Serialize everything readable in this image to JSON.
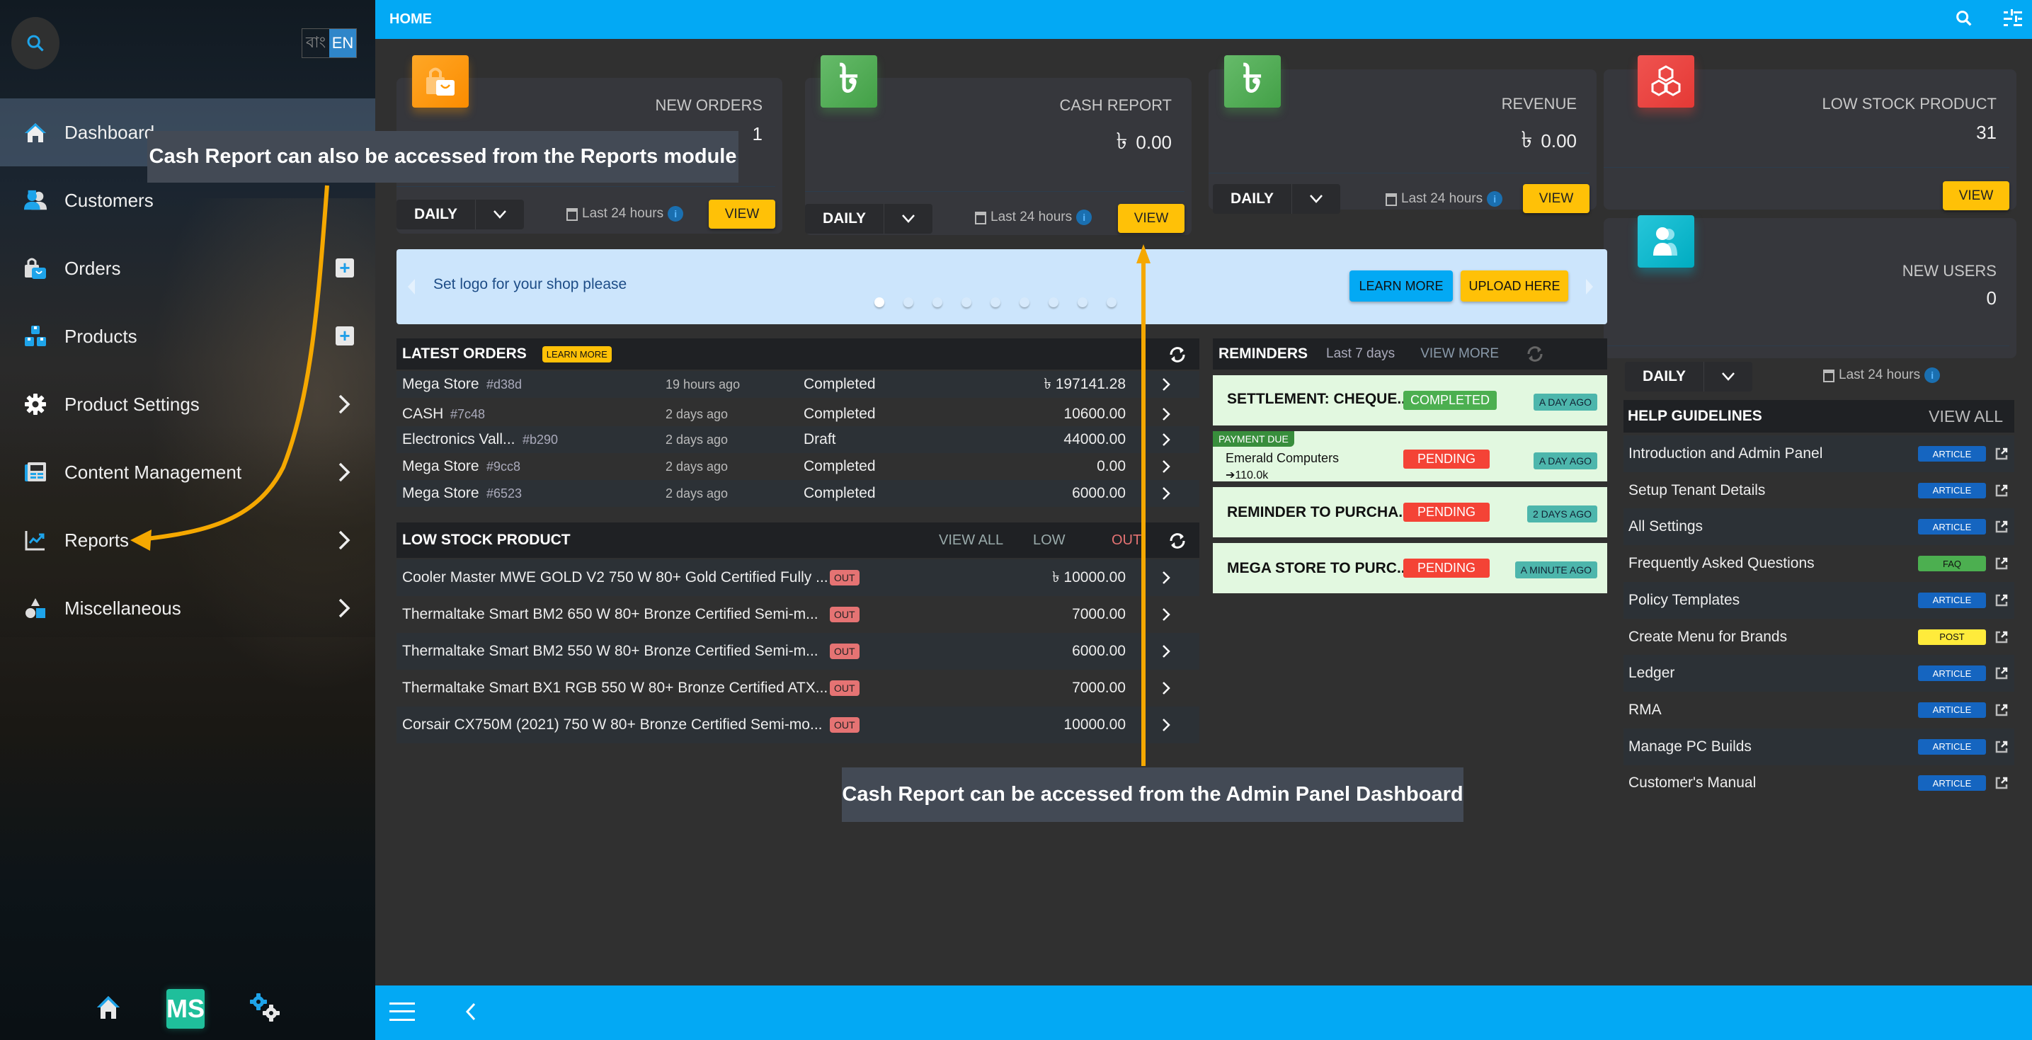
{
  "sidebar": {
    "search_icon": "search-icon",
    "lang": {
      "bn": "বাং",
      "en": "EN",
      "active": "EN"
    },
    "items": [
      {
        "label": "Dashboard",
        "icon": "home-icon",
        "active": true
      },
      {
        "label": "Customers",
        "icon": "customers-icon"
      },
      {
        "label": "Orders",
        "icon": "shopping-bag-icon",
        "action": "plus"
      },
      {
        "label": "Products",
        "icon": "boxes-icon",
        "action": "plus"
      },
      {
        "label": "Product Settings",
        "icon": "gear-icon",
        "action": "chevron"
      },
      {
        "label": "Content Management",
        "icon": "newspaper-icon",
        "action": "chevron"
      },
      {
        "label": "Reports",
        "icon": "chart-icon",
        "action": "chevron"
      },
      {
        "label": "Miscellaneous",
        "icon": "shapes-icon",
        "action": "chevron"
      }
    ],
    "bottom": {
      "logo_text": "MS"
    }
  },
  "topbar": {
    "title": "HOME"
  },
  "cards": {
    "new_orders": {
      "title": "NEW ORDERS",
      "value": "1",
      "period": "DAILY",
      "range": "Last 24 hours",
      "view": "VIEW"
    },
    "cash_report": {
      "title": "CASH REPORT",
      "currency": "৳",
      "value": "0.00",
      "period": "DAILY",
      "range": "Last 24 hours",
      "view": "VIEW"
    },
    "revenue": {
      "title": "REVENUE",
      "currency": "৳",
      "value": "0.00",
      "period": "DAILY",
      "range": "Last 24 hours",
      "view": "VIEW"
    },
    "low_stock": {
      "title": "LOW STOCK PRODUCT",
      "value": "31",
      "view": "VIEW"
    },
    "new_users": {
      "title": "NEW USERS",
      "value": "0",
      "period": "DAILY",
      "range": "Last 24 hours"
    }
  },
  "banner": {
    "text": "Set logo for your shop please",
    "learn_more": "LEARN MORE",
    "upload": "UPLOAD HERE",
    "dots": 9,
    "active_dot": 0
  },
  "latest_orders": {
    "title": "LATEST ORDERS",
    "learn_more": "LEARN MORE",
    "rows": [
      {
        "name": "Mega Store",
        "id": "#d38d",
        "time": "19 hours ago",
        "status": "Completed",
        "amount": "৳ 197141.28"
      },
      {
        "name": "CASH",
        "id": "#7c48",
        "time": "2 days ago",
        "status": "Completed",
        "amount": "10600.00"
      },
      {
        "name": "Electronics Vall...",
        "id": "#b290",
        "time": "2 days ago",
        "status": "Draft",
        "amount": "44000.00"
      },
      {
        "name": "Mega Store",
        "id": "#9cc8",
        "time": "2 days ago",
        "status": "Completed",
        "amount": "0.00"
      },
      {
        "name": "Mega Store",
        "id": "#6523",
        "time": "2 days ago",
        "status": "Completed",
        "amount": "6000.00"
      }
    ]
  },
  "low_stock_list": {
    "title": "LOW STOCK PRODUCT",
    "view_all": "VIEW ALL",
    "low": "LOW",
    "out": "OUT",
    "rows": [
      {
        "name": "Cooler Master MWE GOLD V2 750 W 80+ Gold Certified Fully ...",
        "badge": "OUT",
        "price": "৳ 10000.00"
      },
      {
        "name": "Thermaltake Smart BM2 650 W 80+ Bronze Certified Semi-m...",
        "badge": "OUT",
        "price": "7000.00"
      },
      {
        "name": "Thermaltake Smart BM2 550 W 80+ Bronze Certified Semi-m...",
        "badge": "OUT",
        "price": "6000.00"
      },
      {
        "name": "Thermaltake Smart BX1 RGB 550 W 80+ Bronze Certified ATX...",
        "badge": "OUT",
        "price": "7000.00"
      },
      {
        "name": "Corsair CX750M (2021) 750 W 80+ Bronze Certified Semi-mo...",
        "badge": "OUT",
        "price": "10000.00"
      }
    ]
  },
  "reminders": {
    "title": "REMINDERS",
    "range": "Last 7 days",
    "view_more": "VIEW MORE",
    "items": [
      {
        "title": "SETTLEMENT: CHEQUE...",
        "status": "COMPLETED",
        "ago": "A DAY AGO"
      },
      {
        "tag": "PAYMENT DUE",
        "title": "Emerald Computers",
        "amount": "➔110.0k",
        "status": "PENDING",
        "ago": "A DAY AGO"
      },
      {
        "title": "REMINDER TO PURCHA...",
        "status": "PENDING",
        "ago": "2 DAYS AGO"
      },
      {
        "title": "MEGA STORE TO PURC...",
        "status": "PENDING",
        "ago": "A MINUTE AGO"
      }
    ]
  },
  "help": {
    "title": "HELP GUIDELINES",
    "view_all": "VIEW ALL",
    "items": [
      {
        "label": "Introduction and Admin Panel",
        "tag": "ARTICLE"
      },
      {
        "label": "Setup Tenant Details",
        "tag": "ARTICLE"
      },
      {
        "label": "All Settings",
        "tag": "ARTICLE"
      },
      {
        "label": "Frequently Asked Questions",
        "tag": "FAQ"
      },
      {
        "label": "Policy Templates",
        "tag": "ARTICLE"
      },
      {
        "label": "Create Menu for Brands",
        "tag": "POST"
      },
      {
        "label": "Ledger",
        "tag": "ARTICLE"
      },
      {
        "label": "RMA",
        "tag": "ARTICLE"
      },
      {
        "label": "Manage PC Builds",
        "tag": "ARTICLE"
      },
      {
        "label": "Customer's Manual",
        "tag": "ARTICLE"
      }
    ]
  },
  "annotations": {
    "reports_callout": "Cash Report can also be accessed from the Reports module",
    "dashboard_callout": "Cash Report can be accessed from the Admin Panel Dashboard"
  },
  "colors": {
    "primary": "#03a9f4",
    "accent_yellow": "#ffc107",
    "annotation_arrow": "#f5a800",
    "completed": "#4caf50",
    "pending": "#f44336",
    "article": "#1565c0",
    "faq": "#4caf50",
    "post": "#ffeb3b"
  }
}
